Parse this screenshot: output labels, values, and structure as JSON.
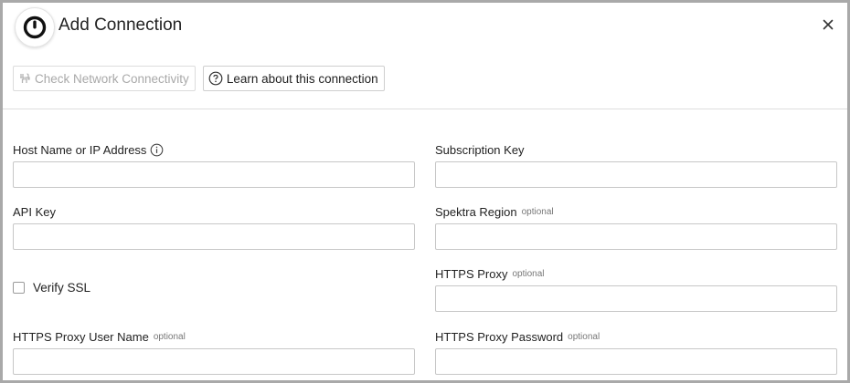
{
  "dialog": {
    "title": "Add Connection",
    "close_icon": "close-icon",
    "logo_icon": "spektra-logo-icon"
  },
  "toolbar": {
    "check_network_label": "Check Network Connectivity",
    "check_network_icon": "network-plug-icon",
    "learn_label": "Learn about this connection",
    "learn_icon": "question-circle-icon"
  },
  "form": {
    "host": {
      "label": "Host Name or IP Address",
      "value": "",
      "info_icon": "info-circle-icon"
    },
    "subscription_key": {
      "label": "Subscription Key",
      "value": ""
    },
    "api_key": {
      "label": "API Key",
      "value": ""
    },
    "spektra_region": {
      "label": "Spektra Region",
      "optional": "optional",
      "value": ""
    },
    "verify_ssl": {
      "label": "Verify SSL",
      "checked": false
    },
    "https_proxy": {
      "label": "HTTPS Proxy",
      "optional": "optional",
      "value": ""
    },
    "https_proxy_user": {
      "label": "HTTPS Proxy User Name",
      "optional": "optional",
      "value": ""
    },
    "https_proxy_password": {
      "label": "HTTPS Proxy Password",
      "optional": "optional",
      "value": ""
    }
  }
}
